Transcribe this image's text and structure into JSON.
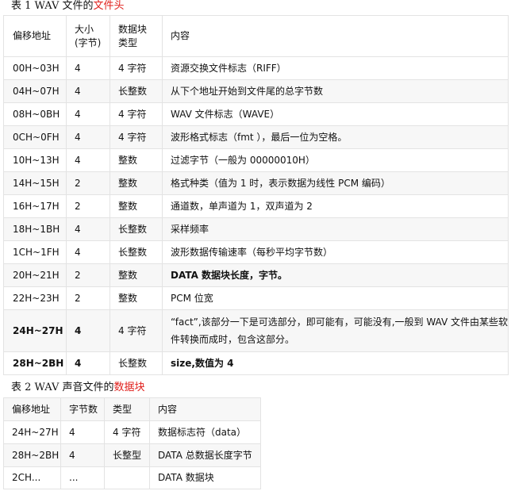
{
  "table1": {
    "caption_prefix": "表 1   WAV 文件的",
    "caption_highlight": "文件头",
    "header": {
      "offset_line1": "偏移地址",
      "size_line1": "大小",
      "size_line2": "(字节)",
      "type_line1": "数据块",
      "type_line2": "类型",
      "content": "内容"
    },
    "rows": [
      {
        "offset": "00H~03H",
        "size": "4",
        "type": "4 字符",
        "content": "资源交换文件标志（RIFF）"
      },
      {
        "offset": "04H~07H",
        "size": "4",
        "type": "长整数",
        "content": "从下个地址开始到文件尾的总字节数"
      },
      {
        "offset": "08H~0BH",
        "size": "4",
        "type": "4 字符",
        "content": "WAV 文件标志（WAVE）"
      },
      {
        "offset": "0CH~0FH",
        "size": "4",
        "type": "4 字符",
        "content": "波形格式标志（fmt ），最后一位为空格。"
      },
      {
        "offset": "10H~13H",
        "size": "4",
        "type": "整数",
        "content": "过滤字节（一般为 00000010H）"
      },
      {
        "offset": "14H~15H",
        "size": "2",
        "type": "整数",
        "content": "格式种类（值为 1 时，表示数据为线性 PCM 编码）"
      },
      {
        "offset": "16H~17H",
        "size": "2",
        "type": "整数",
        "content": "通道数，单声道为 1，双声道为 2"
      },
      {
        "offset": "18H~1BH",
        "size": "4",
        "type": "长整数",
        "content": "采样频率"
      },
      {
        "offset": "1CH~1FH",
        "size": "4",
        "type": "长整数",
        "content": "波形数据传输速率（每秒平均字节数）"
      },
      {
        "offset": "20H~21H",
        "size": "2",
        "type": "整数",
        "content": "DATA 数据块长度，字节。"
      },
      {
        "offset": "22H~23H",
        "size": "2",
        "type": "整数",
        "content": "PCM 位宽"
      },
      {
        "offset": "24H~27H",
        "size": "4",
        "type": "4 字符",
        "content": "“fact”,该部分一下是可选部分，即可能有，可能没有,一般到 WAV 文件由某些软件转换而成时，包含这部分。"
      },
      {
        "offset": "28H~2BH",
        "size": "4",
        "type": "长整数",
        "content": "size,数值为 4"
      }
    ]
  },
  "table2": {
    "caption_prefix": "表 2   WAV 声音文件的",
    "caption_highlight": "数据块",
    "header": {
      "offset": "偏移地址",
      "size": "字节数",
      "type": "类型",
      "content": "内容"
    },
    "rows": [
      {
        "offset": "24H~27H",
        "size": "4",
        "type": "4 字符",
        "content": "数据标志符（data）"
      },
      {
        "offset": "28H~2BH",
        "size": "4",
        "type": "长整型",
        "content": "DATA 总数据长度字节"
      },
      {
        "offset": "2CH...",
        "size": "...",
        "type": "",
        "content": "DATA 数据块"
      }
    ]
  },
  "colors": {
    "highlight": "#e0201c",
    "border": "#e3e3e3",
    "shade": "#f7f7f7"
  }
}
